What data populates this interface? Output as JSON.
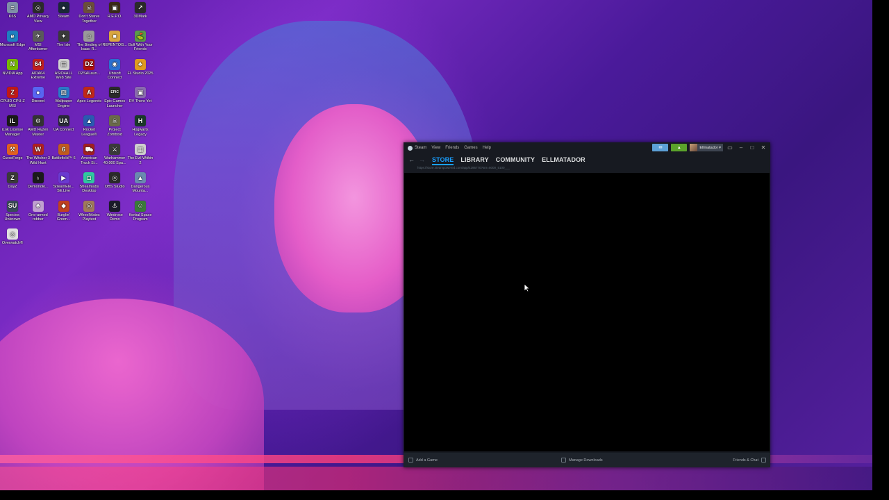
{
  "desktop": {
    "icons": [
      {
        "label": "K6S",
        "color": "#7f8ea8",
        "glyph": "≡"
      },
      {
        "label": "AMD Privacy View",
        "color": "#2b2b2b",
        "glyph": "◎"
      },
      {
        "label": "Steam",
        "color": "#1b2838",
        "glyph": "●"
      },
      {
        "label": "Don't Starve Together",
        "color": "#6b4e3a",
        "glyph": "☠"
      },
      {
        "label": "R.E.P.O.",
        "color": "#3b2a18",
        "glyph": "▣"
      },
      {
        "label": "3DMark",
        "color": "#2a2a2a",
        "glyph": "↗"
      },
      {
        "label": "Microsoft Edge",
        "color": "#1e7fc0",
        "glyph": "e"
      },
      {
        "label": "MSI Afterburner",
        "color": "#5a5a5a",
        "glyph": "✈"
      },
      {
        "label": "The Isle",
        "color": "#3a3a3a",
        "glyph": "✦"
      },
      {
        "label": "The Binding of Isaac R...",
        "color": "#9a9a9a",
        "glyph": "☺"
      },
      {
        "label": "REPENTOG...",
        "color": "#d9a640",
        "glyph": "■"
      },
      {
        "label": "Golf With Your Friends",
        "color": "#5a9a4a",
        "glyph": "⛳"
      },
      {
        "label": "NVIDIA App",
        "color": "#76b900",
        "glyph": "N"
      },
      {
        "label": "AIDA64 Extreme",
        "color": "#c02020",
        "glyph": "64"
      },
      {
        "label": "ASIO4ALL Web Site",
        "color": "#d0d0d0",
        "glyph": "▤"
      },
      {
        "label": "DZSALaun...",
        "color": "#b01010",
        "glyph": "DZ"
      },
      {
        "label": "Ubisoft Connect",
        "color": "#2a6fd0",
        "glyph": "◉"
      },
      {
        "label": "FL Studio 2025",
        "color": "#e09a20",
        "glyph": "♣"
      },
      {
        "label": "CPUID CPU-Z MSI",
        "color": "#c01818",
        "glyph": "Z"
      },
      {
        "label": "Discord",
        "color": "#5865f2",
        "glyph": "●"
      },
      {
        "label": "Wallpaper Engine",
        "color": "#2a7ac8",
        "glyph": "▧"
      },
      {
        "label": "Apex Legends",
        "color": "#c02818",
        "glyph": "A"
      },
      {
        "label": "Epic Games Launcher",
        "color": "#2a2a2a",
        "glyph": "EPIC"
      },
      {
        "label": "RV There Yet",
        "color": "#8a6ab0",
        "glyph": "▣"
      },
      {
        "label": "iLok License Manager",
        "color": "#1a1a1a",
        "glyph": "iL"
      },
      {
        "label": "AMD Ryzen Master",
        "color": "#333",
        "glyph": "⚙"
      },
      {
        "label": "UA Connect",
        "color": "#2a2a3a",
        "glyph": "UA"
      },
      {
        "label": "Rocket League®",
        "color": "#2a5ab0",
        "glyph": "▲"
      },
      {
        "label": "Project Zomboid",
        "color": "#6a6a4a",
        "glyph": "☠"
      },
      {
        "label": "Hogwarts Legacy",
        "color": "#1a3a2a",
        "glyph": "H"
      },
      {
        "label": "CurseForge",
        "color": "#e06020",
        "glyph": "⚒"
      },
      {
        "label": "The Witcher 3 Wild Hunt",
        "color": "#b02020",
        "glyph": "W"
      },
      {
        "label": "Battlefield™ 6",
        "color": "#c05a20",
        "glyph": "6"
      },
      {
        "label": "American Truck Si...",
        "color": "#a02020",
        "glyph": "⛟"
      },
      {
        "label": "Warhammer 40,000 Spa...",
        "color": "#3a3a3a",
        "glyph": "⚔"
      },
      {
        "label": "The Evil Within 2",
        "color": "#cfcfcf",
        "glyph": "▦"
      },
      {
        "label": "DayZ",
        "color": "#3a3a3a",
        "glyph": "Z"
      },
      {
        "label": "Demonolo...",
        "color": "#1a1a1a",
        "glyph": "♁"
      },
      {
        "label": "StreamEle... SE.Live",
        "color": "#6a3ad0",
        "glyph": "▶"
      },
      {
        "label": "Streamlabs Desktop",
        "color": "#30c8a0",
        "glyph": "◘"
      },
      {
        "label": "OBS Studio",
        "color": "#2a2a2a",
        "glyph": "◎"
      },
      {
        "label": "Dangerous Mounta...",
        "color": "#6a8ab0",
        "glyph": "▲"
      },
      {
        "label": "Species Unknown",
        "color": "#3a4a5a",
        "glyph": "SU"
      },
      {
        "label": "One-armed robber",
        "color": "#c0a0d0",
        "glyph": "♣"
      },
      {
        "label": "Burglin' Gnom...",
        "color": "#c04020",
        "glyph": "◆"
      },
      {
        "label": "WheelMates Playtest",
        "color": "#a07a5a",
        "glyph": "◎"
      },
      {
        "label": "Windrose Demo",
        "color": "#1a1a2a",
        "glyph": "⚓"
      },
      {
        "label": "Kerbal Space Program",
        "color": "#3a7a3a",
        "glyph": "☺"
      },
      {
        "label": "Overwatch®",
        "color": "#e0e0e0",
        "glyph": "◎"
      }
    ]
  },
  "steam": {
    "brand": "Steam",
    "menu": [
      "View",
      "Friends",
      "Games",
      "Help"
    ],
    "username": "Ellmatador",
    "tabs": [
      "STORE",
      "LIBRARY",
      "COMMUNITY",
      "ELLMATADOR"
    ],
    "active_tab": "STORE",
    "url": "https://store.steampowered.com/app/4295770?snr=5000_5100___",
    "bottom": {
      "add_game": "Add a Game",
      "manage_downloads": "Manage Downloads",
      "friends_chat": "Friends & Chat"
    },
    "colors": {
      "accent": "#1a9fff",
      "broadcast": "#5c9fd6",
      "notification": "#5ba32b",
      "chrome": "#171a21"
    }
  }
}
